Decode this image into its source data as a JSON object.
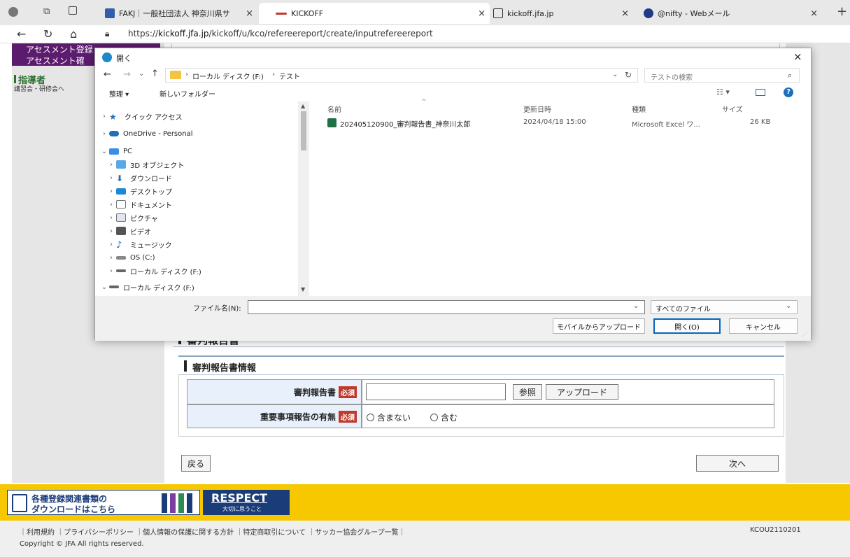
{
  "browser": {
    "tabs": [
      {
        "label": "FAKJ｜一般社団法人 神奈川県サ"
      },
      {
        "label": "KICKOFF"
      },
      {
        "label": "kickoff.jfa.jp"
      },
      {
        "label": "@nifty - Webメール"
      }
    ],
    "url_prefix": "https://",
    "url_host": "kickoff.jfa.jp",
    "url_path": "/kickoff/u/kco/refereereport/create/inputrefereereport"
  },
  "sidebar": {
    "items": [
      "アセスメント登録",
      "アセスメント確"
    ],
    "section_title": "指導者",
    "section_sub": "講習会・研修会へ"
  },
  "dialog": {
    "title": "開く",
    "breadcrumb": [
      "ローカル ディスク (F:)",
      "テスト"
    ],
    "search_placeholder": "テストの検索",
    "organize_label": "整理 ▾",
    "new_folder_label": "新しいフォルダー",
    "tree": [
      {
        "label": "クイック アクセス",
        "icon": "star-icon"
      },
      {
        "label": "OneDrive - Personal",
        "icon": "cloud-icon"
      },
      {
        "label": "PC",
        "icon": "pc-icon"
      },
      {
        "label": "3D オブジェクト",
        "icon": "cube-icon"
      },
      {
        "label": "ダウンロード",
        "icon": "download-icon"
      },
      {
        "label": "デスクトップ",
        "icon": "desktop-icon"
      },
      {
        "label": "ドキュメント",
        "icon": "document-icon"
      },
      {
        "label": "ピクチャ",
        "icon": "picture-icon"
      },
      {
        "label": "ビデオ",
        "icon": "video-icon"
      },
      {
        "label": "ミュージック",
        "icon": "music-icon"
      },
      {
        "label": "OS (C:)",
        "icon": "drive-icon"
      },
      {
        "label": "ローカル ディスク (F:)",
        "icon": "drive-icon"
      },
      {
        "label": "ローカル ディスク (F:)",
        "icon": "drive-icon"
      }
    ],
    "columns": [
      "名前",
      "更新日時",
      "種類",
      "サイズ"
    ],
    "files": [
      {
        "name": "202405120900_審判報告書_神奈川太郎",
        "modified": "2024/04/18 15:00",
        "type": "Microsoft Excel ワ...",
        "size": "26 KB"
      }
    ],
    "filename_label": "ファイル名(N):",
    "filename_value": "",
    "filetype_value": "すべてのファイル",
    "mobile_upload_label": "モバイルからアップロード",
    "open_label": "開く(O)",
    "cancel_label": "キャンセル"
  },
  "form": {
    "hidden_header": "審判報告書",
    "section_title": "審判報告書情報",
    "row1_label": "審判報告書",
    "row2_label": "重要事項報告の有無",
    "required_badge": "必須",
    "browse_label": "参照",
    "upload_label": "アップロード",
    "radio_no": "含まない",
    "radio_yes": "含む",
    "back_label": "戻る",
    "next_label": "次へ"
  },
  "banners": {
    "download_line1": "各種登録関連書類の",
    "download_line2": "ダウンロードはこちら",
    "respect": "RESPECT",
    "respect_sub": "大切に思うこと"
  },
  "footer": {
    "links": "｜利用規約 ｜プライバシーポリシー ｜個人情報の保護に関する方針 ｜特定商取引について ｜サッカー協会グループ一覧｜",
    "code": "KCOU2110201",
    "copyright": "Copyright © JFA All rights reserved."
  },
  "colors": {
    "accent": "#0067c0",
    "sidebar": "#5c1c6e",
    "footer_band": "#f7c800"
  }
}
